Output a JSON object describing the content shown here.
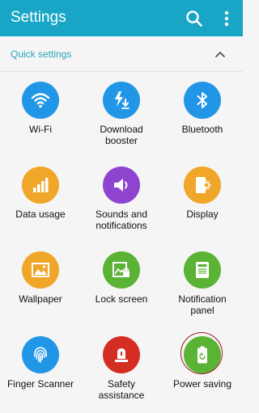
{
  "app_bar": {
    "title": "Settings",
    "search_icon": "search-icon",
    "more_icon": "more-vertical-icon",
    "color": "#18a5c6"
  },
  "quick_settings": {
    "header": "Quick settings",
    "chevron_icon": "chevron-up-icon",
    "items": [
      {
        "label": "Wi-Fi",
        "icon": "wifi-icon",
        "color": "#2196e6"
      },
      {
        "label": "Download\nbooster",
        "icon": "download-booster-icon",
        "color": "#2196e6"
      },
      {
        "label": "Bluetooth",
        "icon": "bluetooth-icon",
        "color": "#2196e6"
      },
      {
        "label": "Data usage",
        "icon": "data-usage-icon",
        "color": "#f0a629"
      },
      {
        "label": "Sounds and\nnotifications",
        "icon": "sound-icon",
        "color": "#8e44cf"
      },
      {
        "label": "Display",
        "icon": "display-icon",
        "color": "#f0a629"
      },
      {
        "label": "Wallpaper",
        "icon": "wallpaper-icon",
        "color": "#f0a629"
      },
      {
        "label": "Lock screen",
        "icon": "lock-screen-icon",
        "color": "#5ab334"
      },
      {
        "label": "Notification\npanel",
        "icon": "notification-panel-icon",
        "color": "#5ab334"
      },
      {
        "label": "Finger Scanner",
        "icon": "fingerprint-icon",
        "color": "#2196e6"
      },
      {
        "label": "Safety\nassistance",
        "icon": "safety-alert-icon",
        "color": "#d42e23"
      },
      {
        "label": "Power saving",
        "icon": "battery-recycle-icon",
        "color": "#5ab334"
      }
    ]
  }
}
